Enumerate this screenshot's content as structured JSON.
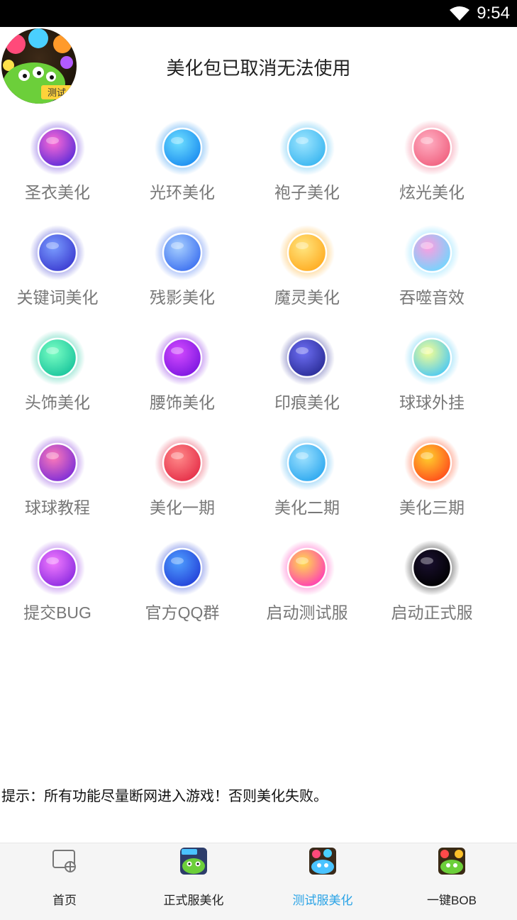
{
  "status_bar": {
    "time": "9:54",
    "wifi_icon": "wifi-icon"
  },
  "header": {
    "title": "美化包已取消无法使用",
    "logo_icon": "game-logo-icon",
    "logo_text": "测试"
  },
  "items": [
    {
      "label": "圣衣美化",
      "icon": "purple-galaxy-orb-icon",
      "colors": [
        "#ff6bd6",
        "#5a2bd8"
      ]
    },
    {
      "label": "光环美化",
      "icon": "cyan-halo-orb-icon",
      "colors": [
        "#6fe0ff",
        "#1a8cf0"
      ]
    },
    {
      "label": "袍子美化",
      "icon": "festive-ring-orb-icon",
      "colors": [
        "#9fe6ff",
        "#38b5f0"
      ]
    },
    {
      "label": "炫光美化",
      "icon": "flower-orb-icon",
      "colors": [
        "#ffb0c4",
        "#f0607e"
      ]
    },
    {
      "label": "关键词美化",
      "icon": "keyword-orb-icon",
      "colors": [
        "#7a9dff",
        "#3a3ad0"
      ]
    },
    {
      "label": "残影美化",
      "icon": "afterimage-orb-icon",
      "colors": [
        "#a8d0ff",
        "#3b6ff0"
      ]
    },
    {
      "label": "魔灵美化",
      "icon": "golden-orb-icon",
      "colors": [
        "#ffe680",
        "#ffab20"
      ]
    },
    {
      "label": "吞噬音效",
      "icon": "rainbow-border-orb-icon",
      "colors": [
        "#ff9de0",
        "#6dd8ff"
      ]
    },
    {
      "label": "头饰美化",
      "icon": "green-orb-icon",
      "colors": [
        "#7bffc4",
        "#18c49c"
      ]
    },
    {
      "label": "腰饰美化",
      "icon": "violet-orb-icon",
      "colors": [
        "#d54bff",
        "#7b16e0"
      ]
    },
    {
      "label": "印痕美化",
      "icon": "navy-orb-icon",
      "colors": [
        "#6e6ff5",
        "#2a2c96"
      ]
    },
    {
      "label": "球球外挂",
      "icon": "lemon-orb-icon",
      "colors": [
        "#f7ff92",
        "#49c8f5"
      ]
    },
    {
      "label": "球球教程",
      "icon": "pink-violet-orb-icon",
      "colors": [
        "#ff7ab8",
        "#7a2bd8"
      ]
    },
    {
      "label": "美化一期",
      "icon": "red-orb-icon",
      "colors": [
        "#ff8a8a",
        "#e52d47"
      ]
    },
    {
      "label": "美化二期",
      "icon": "sky-orb-icon",
      "colors": [
        "#9fe2ff",
        "#2ba7ef"
      ]
    },
    {
      "label": "美化三期",
      "icon": "orange-orb-icon",
      "colors": [
        "#ffd02c",
        "#ff4a1c"
      ]
    },
    {
      "label": "提交BUG",
      "icon": "magenta-orb-icon",
      "colors": [
        "#f47cff",
        "#8a2ae0"
      ]
    },
    {
      "label": "官方QQ群",
      "icon": "blue-orb-icon",
      "colors": [
        "#4fa0ff",
        "#2340d8"
      ]
    },
    {
      "label": "启动测试服",
      "icon": "sunburst-orb-icon",
      "colors": [
        "#ffe04a",
        "#ff3ab8"
      ]
    },
    {
      "label": "启动正式服",
      "icon": "black-hole-orb-icon",
      "colors": [
        "#1a1030",
        "#000000"
      ]
    }
  ],
  "tip": "提示：所有功能尽量断网进入游戏！否则美化失败。",
  "tabbar": {
    "tabs": [
      {
        "label": "首页",
        "icon": "home-screen-icon",
        "active": false
      },
      {
        "label": "正式服美化",
        "icon": "official-server-icon",
        "active": false
      },
      {
        "label": "测试服美化",
        "icon": "test-server-icon",
        "active": true
      },
      {
        "label": "一键BOB",
        "icon": "one-key-bob-icon",
        "active": false
      }
    ],
    "active_color": "#2aa3e6"
  }
}
